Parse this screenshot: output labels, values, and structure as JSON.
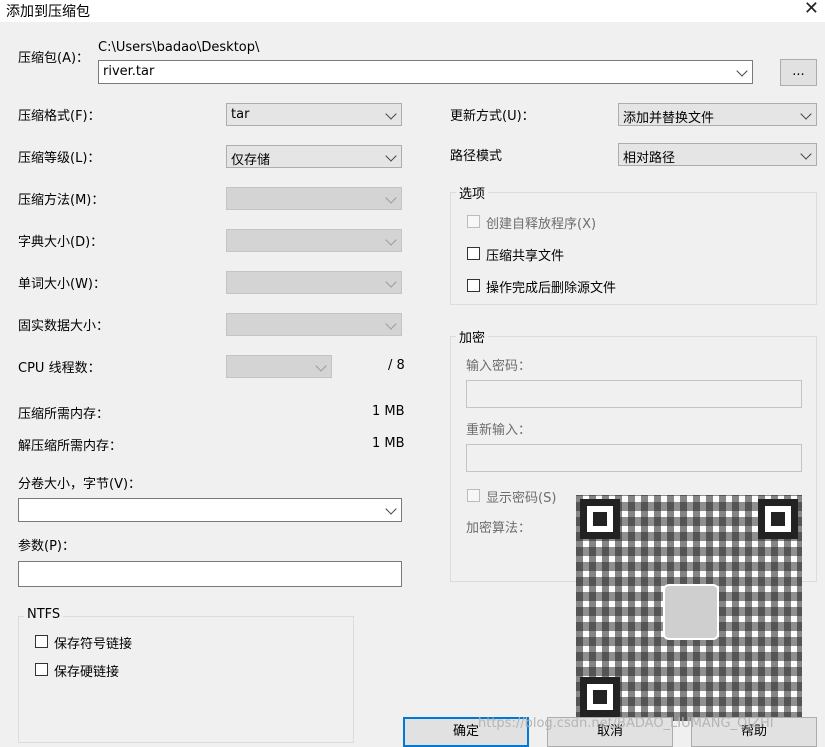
{
  "window": {
    "title": "添加到压缩包"
  },
  "archive": {
    "label": "压缩包(A)：",
    "path": "C:\\Users\\badao\\Desktop\\",
    "value": "river.tar",
    "browse_label": "..."
  },
  "left": {
    "format_label": "压缩格式(F)：",
    "format_value": "tar",
    "level_label": "压缩等级(L)：",
    "level_value": "仅存储",
    "method_label": "压缩方法(M)：",
    "dict_label": "字典大小(D)：",
    "word_label": "单词大小(W)：",
    "solid_label": "固实数据大小：",
    "cpu_label": "CPU 线程数：",
    "cpu_total": "/ 8",
    "mem_comp_label": "压缩所需内存：",
    "mem_comp_value": "1 MB",
    "mem_decomp_label": "解压缩所需内存：",
    "mem_decomp_value": "1 MB",
    "volume_label": "分卷大小，字节(V)：",
    "volume_value": "",
    "params_label": "参数(P)：",
    "params_value": ""
  },
  "ntfs": {
    "title": "NTFS",
    "symlinks_label": "保存符号链接",
    "hardlinks_label": "保存硬链接"
  },
  "right": {
    "update_label": "更新方式(U)：",
    "update_value": "添加并替换文件",
    "path_label": "路径模式",
    "path_value": "相对路径"
  },
  "options": {
    "title": "选项",
    "sfx_label": "创建自释放程序(X)",
    "shared_label": "压缩共享文件",
    "delete_label": "操作完成后删除源文件"
  },
  "encryption": {
    "title": "加密",
    "password_label": "输入密码：",
    "reenter_label": "重新输入：",
    "show_label": "显示密码(S)",
    "method_label": "加密算法："
  },
  "buttons": {
    "ok": "确定",
    "cancel": "取消",
    "help": "帮助"
  },
  "watermark": "https://blog.csdn.net/BADAO_LIUMANG_QIZHI"
}
